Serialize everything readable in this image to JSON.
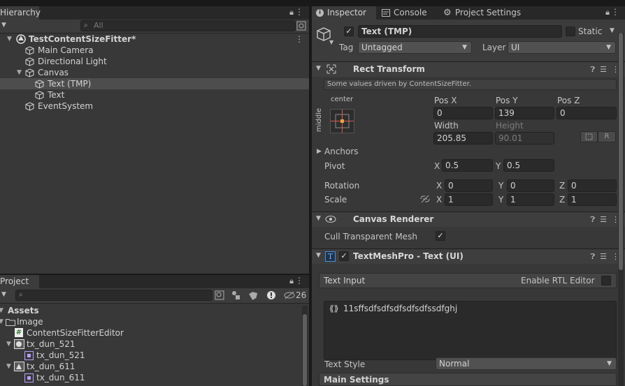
{
  "hierarchy": {
    "tab": "Hierarchy",
    "search_placeholder": "All",
    "root": "TestContentSizeFitter*",
    "items": [
      "Main Camera",
      "Directional Light",
      "Canvas",
      "Text (TMP)",
      "Text",
      "EventSystem"
    ]
  },
  "project": {
    "tab": "Project",
    "hidden_count": "26",
    "assets_label": "Assets",
    "items": [
      "Image",
      "ContentSizeFitterEditor",
      "tx_dun_521",
      "tx_dun_521",
      "tx_dun_611",
      "tx_dun_611"
    ]
  },
  "inspector": {
    "tabs": [
      "Inspector",
      "Console",
      "Project Settings"
    ],
    "object_name": "Text (TMP)",
    "static_label": "Static",
    "tag_label": "Tag",
    "tag_value": "Untagged",
    "layer_label": "Layer",
    "layer_value": "UI",
    "rect_transform": {
      "title": "Rect Transform",
      "info": "Some values driven by ContentSizeFitter.",
      "anchor_h": "center",
      "anchor_v": "middle",
      "pos_x_label": "Pos X",
      "pos_x": "0",
      "pos_y_label": "Pos Y",
      "pos_y": "139",
      "pos_z_label": "Pos Z",
      "pos_z": "0",
      "width_label": "Width",
      "width": "205.85",
      "height_label": "Height",
      "height": "90.01",
      "r_button": "R",
      "anchors_label": "Anchors",
      "pivot_label": "Pivot",
      "pivot_x": "0.5",
      "pivot_y": "0.5",
      "rotation_label": "Rotation",
      "rot_x": "0",
      "rot_y": "0",
      "rot_z": "0",
      "scale_label": "Scale",
      "scale_x": "1",
      "scale_y": "1",
      "scale_z": "1",
      "x": "X",
      "y": "Y",
      "z": "Z"
    },
    "canvas_renderer": {
      "title": "Canvas Renderer",
      "cull_label": "Cull Transparent Mesh"
    },
    "tmp": {
      "title": "TextMeshPro - Text (UI)",
      "text_input_label": "Text Input",
      "rtl_label": "Enable RTL Editor",
      "text_value": "11sffsdfsdfsdfsdfsdfssdfghj",
      "text_style_label": "Text Style",
      "text_style_value": "Normal",
      "main_settings": "Main Settings"
    }
  },
  "colors": {
    "panel": "#383838",
    "selection": "#4d4d4d",
    "accent": "#4a90d9",
    "anchor": "#e05a4a"
  }
}
